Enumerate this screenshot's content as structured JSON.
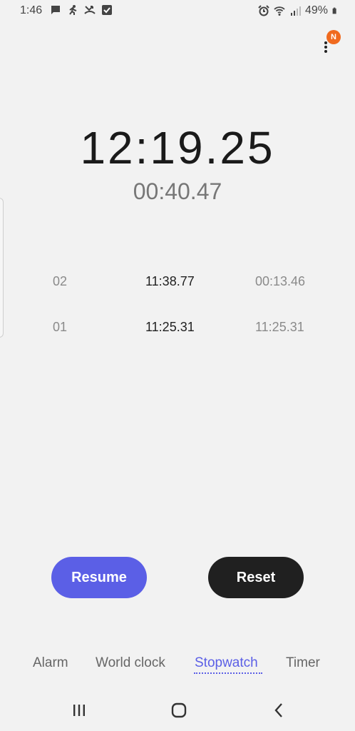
{
  "status_bar": {
    "time": "1:46",
    "battery": "49%",
    "icons": [
      "message-icon",
      "running-icon",
      "missed-call-icon",
      "checkbox-icon",
      "alarm-icon",
      "wifi-icon",
      "signal-icon",
      "battery-icon"
    ]
  },
  "header": {
    "notification_badge": "N"
  },
  "stopwatch": {
    "main_time": "12:19.25",
    "lap_time": "00:40.47"
  },
  "laps": [
    {
      "number": "02",
      "total": "11:38.77",
      "split": "00:13.46"
    },
    {
      "number": "01",
      "total": "11:25.31",
      "split": "11:25.31"
    }
  ],
  "buttons": {
    "resume": "Resume",
    "reset": "Reset"
  },
  "tabs": {
    "alarm": "Alarm",
    "world_clock": "World clock",
    "stopwatch": "Stopwatch",
    "timer": "Timer",
    "active": "Stopwatch"
  },
  "colors": {
    "accent": "#5b5fe6",
    "reset_button": "#202020",
    "badge": "#f06a1f",
    "background": "#f2f2f2"
  }
}
